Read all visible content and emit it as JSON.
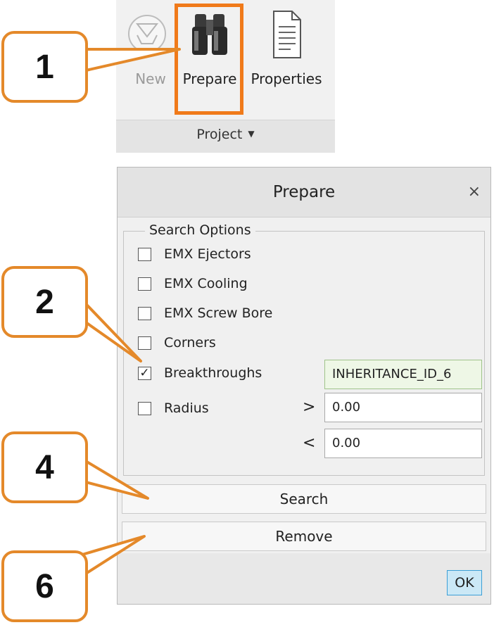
{
  "ribbon": {
    "buttons": [
      {
        "label": "New",
        "icon": "new-mold-icon",
        "enabled": false
      },
      {
        "label": "Prepare",
        "icon": "binoculars-icon",
        "enabled": true,
        "highlighted": true
      },
      {
        "label": "Properties",
        "icon": "document-icon",
        "enabled": true
      }
    ],
    "group_label": "Project",
    "group_caret": "▼"
  },
  "callouts": [
    "1",
    "2",
    "4",
    "6"
  ],
  "dialog": {
    "title": "Prepare",
    "close_glyph": "×",
    "search_options": {
      "legend": "Search Options",
      "items": [
        {
          "label": "EMX Ejectors",
          "checked": false,
          "mark": ""
        },
        {
          "label": "EMX Cooling",
          "checked": false,
          "mark": ""
        },
        {
          "label": "EMX Screw Bore",
          "checked": false,
          "mark": ""
        },
        {
          "label": "Corners",
          "checked": false,
          "mark": ""
        },
        {
          "label": "Breakthroughs",
          "checked": true,
          "mark": "✓"
        },
        {
          "label": "Radius",
          "checked": false,
          "mark": ""
        }
      ],
      "breakthroughs_value": "INHERITANCE_ID_6",
      "radius": {
        "gt_symbol": ">",
        "gt_value": "0.00",
        "lt_symbol": "<",
        "lt_value": "0.00"
      }
    },
    "search_button": "Search",
    "remove_button": "Remove",
    "ok_button": "OK"
  },
  "colors": {
    "highlight": "#f07a1a",
    "callout_border": "#e4892a",
    "ok_border": "#3c9fd6",
    "ok_fill": "#cbe8f6",
    "breakthrough_field": "#eef7e6"
  }
}
